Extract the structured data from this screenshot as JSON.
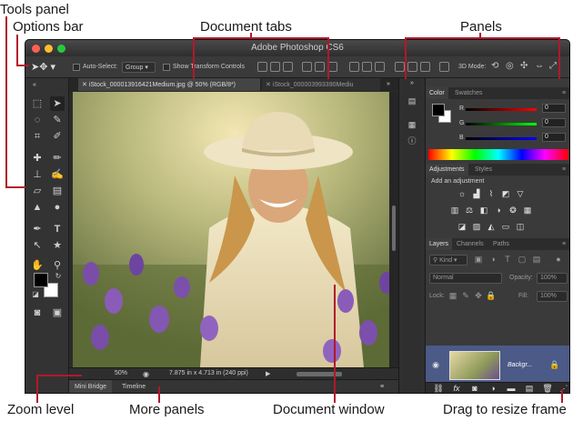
{
  "callouts": {
    "tools_panel": "Tools panel",
    "options_bar": "Options bar",
    "document_tabs": "Document tabs",
    "panels": "Panels",
    "zoom_level": "Zoom level",
    "more_panels": "More panels",
    "document_window": "Document window",
    "drag_to_resize": "Drag to resize frame"
  },
  "window": {
    "title": "Adobe Photoshop CS6",
    "traffic_lights": [
      "#ff5f57",
      "#ffbd2e",
      "#28c840"
    ]
  },
  "options_bar": {
    "auto_select_label": "Auto-Select:",
    "auto_select_value": "Group",
    "show_transform_controls": "Show Transform Controls",
    "mode_3d_label": "3D Mode:"
  },
  "document_tabs": [
    {
      "label": "iStock_000013916421Medium.jpg @ 50% (RGB/8*)",
      "active": true
    },
    {
      "label": "iStock_000003993390Mediu",
      "active": false
    }
  ],
  "status": {
    "zoom": "50%",
    "doc_info": "7.875 in x 4.713 in (240 ppi)"
  },
  "bottom_tabs": [
    "Mini Bridge",
    "Timeline"
  ],
  "color_panel": {
    "tabs": [
      "Color",
      "Swatches"
    ],
    "r_label": "R",
    "g_label": "G",
    "b_label": "B",
    "r_value": "0",
    "g_value": "0",
    "b_value": "0"
  },
  "adjustments_panel": {
    "tabs": [
      "Adjustments",
      "Styles"
    ],
    "heading": "Add an adjustment"
  },
  "layers_panel": {
    "tabs": [
      "Layers",
      "Channels",
      "Paths"
    ],
    "kind_filter": "Kind",
    "blend_mode": "Normal",
    "opacity_label": "Opacity:",
    "opacity_value": "100%",
    "lock_label": "Lock:",
    "fill_label": "Fill:",
    "fill_value": "100%",
    "layer_name": "Backgr..."
  },
  "colors": {
    "accent_red": "#b2182b",
    "ui_dark": "#2b2b2b",
    "selected_layer": "#4b5a86"
  }
}
